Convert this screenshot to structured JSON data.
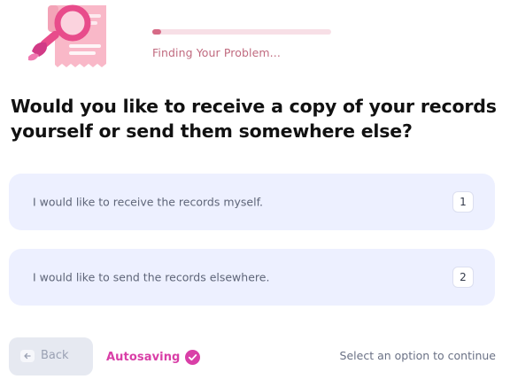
{
  "progress": {
    "label": "Finding Your Problem...",
    "fraction": 0.05,
    "colors": {
      "fill": "#d66a86",
      "track": "#f7dfe6"
    }
  },
  "illustration": {
    "icon": "records-search-illustration"
  },
  "question": "Would you like to receive a copy of your records yourself or send them somewhere else?",
  "options": [
    {
      "label": "I would like to receive the records myself.",
      "key": "1"
    },
    {
      "label": "I would like to send the records elsewhere.",
      "key": "2"
    }
  ],
  "footer": {
    "back_label": "Back",
    "back_icon": "arrow-left-icon",
    "autosave_label": "Autosaving",
    "autosave_icon": "check-circle-icon",
    "status": "Select an option to continue"
  },
  "colors": {
    "accent": "#d93fa7",
    "option_bg": "#edf0ff",
    "question_text": "#111111"
  }
}
